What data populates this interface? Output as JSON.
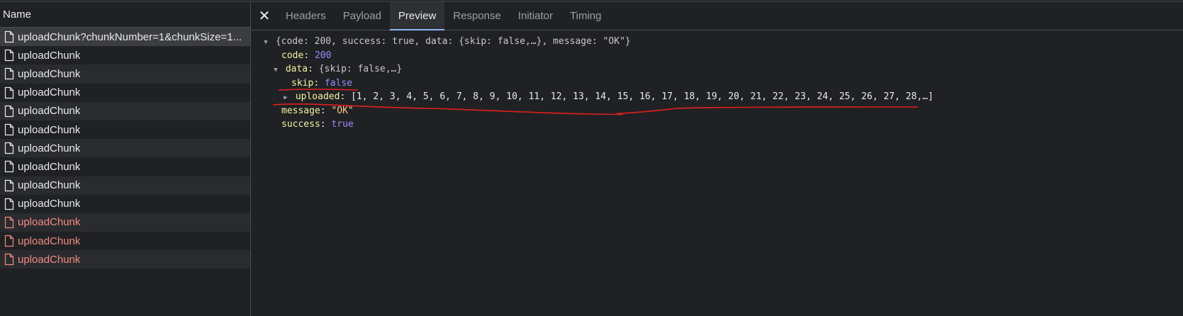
{
  "left_pane": {
    "header": "Name",
    "requests": [
      {
        "name": "uploadChunk?chunkNumber=1&chunkSize=1...",
        "status": "selected"
      },
      {
        "name": "uploadChunk",
        "status": "ok"
      },
      {
        "name": "uploadChunk",
        "status": "ok"
      },
      {
        "name": "uploadChunk",
        "status": "ok"
      },
      {
        "name": "uploadChunk",
        "status": "ok"
      },
      {
        "name": "uploadChunk",
        "status": "ok"
      },
      {
        "name": "uploadChunk",
        "status": "ok"
      },
      {
        "name": "uploadChunk",
        "status": "ok"
      },
      {
        "name": "uploadChunk",
        "status": "ok"
      },
      {
        "name": "uploadChunk",
        "status": "ok"
      },
      {
        "name": "uploadChunk",
        "status": "error"
      },
      {
        "name": "uploadChunk",
        "status": "error"
      },
      {
        "name": "uploadChunk",
        "status": "error"
      }
    ]
  },
  "tabs": {
    "close": "✕",
    "items": [
      "Headers",
      "Payload",
      "Preview",
      "Response",
      "Initiator",
      "Timing"
    ],
    "active": "Preview"
  },
  "preview": {
    "root_summary": "{code: 200, success: true, data: {skip: false,…}, message: \"OK\"}",
    "code_key": "code",
    "code_value": "200",
    "data_key": "data",
    "data_summary": "{skip: false,…}",
    "skip_key": "skip",
    "skip_value": "false",
    "uploaded_key": "uploaded",
    "uploaded_summary": "[1, 2, 3, 4, 5, 6, 7, 8, 9, 10, 11, 12, 13, 14, 15, 16, 17, 18, 19, 20, 21, 22, 23, 24, 25, 26, 27, 28,…]",
    "message_key": "message",
    "message_value": "\"OK\"",
    "success_key": "success",
    "success_value": "true"
  },
  "colors": {
    "background": "#202124",
    "annotation_red": "#e0201c",
    "error_text": "#f28b82",
    "active_tab_underline": "#8ab4f8"
  }
}
